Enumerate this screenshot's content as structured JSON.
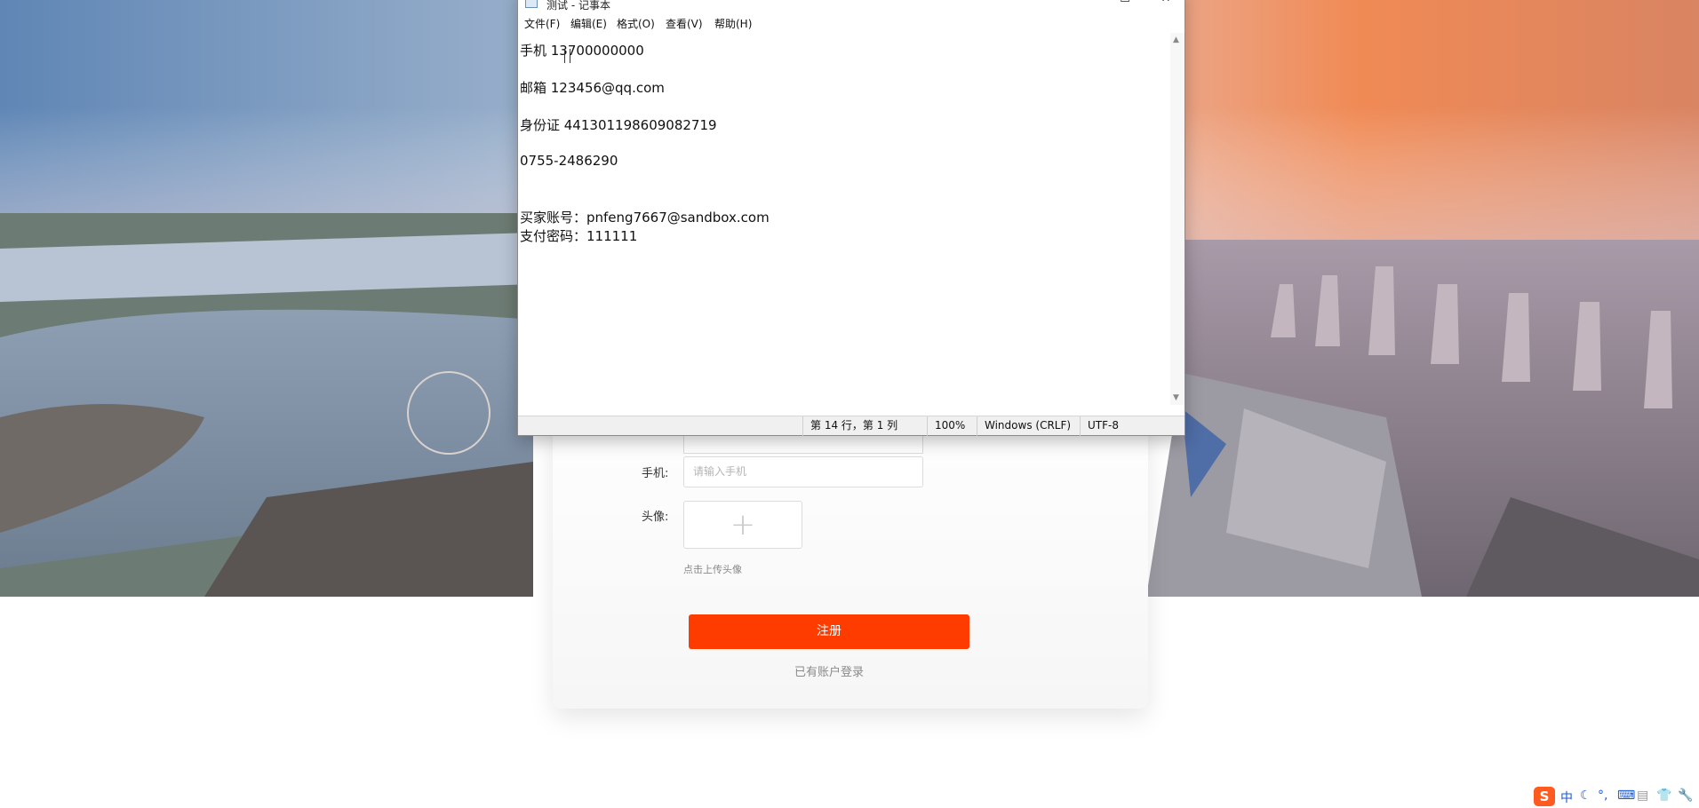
{
  "notepad": {
    "title": "测试 - 记事本",
    "menu": [
      "文件(F)",
      "编辑(E)",
      "格式(O)",
      "查看(V)",
      "帮助(H)"
    ],
    "lines": [
      "手机 13700000000",
      "邮箱 123456@qq.com",
      "身份证 441301198609082719",
      "0755-2486290",
      "买家账号：pnfeng7667@sandbox.com",
      "支付密码：111111"
    ],
    "status": {
      "position": "第 14 行，第 1 列",
      "zoom": "100%",
      "line_ending": "Windows (CRLF)",
      "encoding": "UTF-8"
    },
    "controls": {
      "minimize": "—",
      "maximize": "☐",
      "close": "✕"
    }
  },
  "register_form": {
    "phone_label": "手机:",
    "phone_placeholder": "请输入手机",
    "avatar_label": "头像:",
    "avatar_plus": "+",
    "avatar_hint": "点击上传头像",
    "submit_label": "注册",
    "login_link": "已有账户登录"
  },
  "tray": {
    "ime_logo": "S",
    "ime_mode": "中",
    "icons": [
      "moon-icon",
      "punctuation-icon",
      "keyboard-icon",
      "clipboard-icon",
      "skin-icon",
      "wrench-icon"
    ]
  },
  "colors": {
    "accent": "#ff3c00",
    "sogou": "#ff5a1f",
    "tray_blue": "#1a5ad1"
  }
}
